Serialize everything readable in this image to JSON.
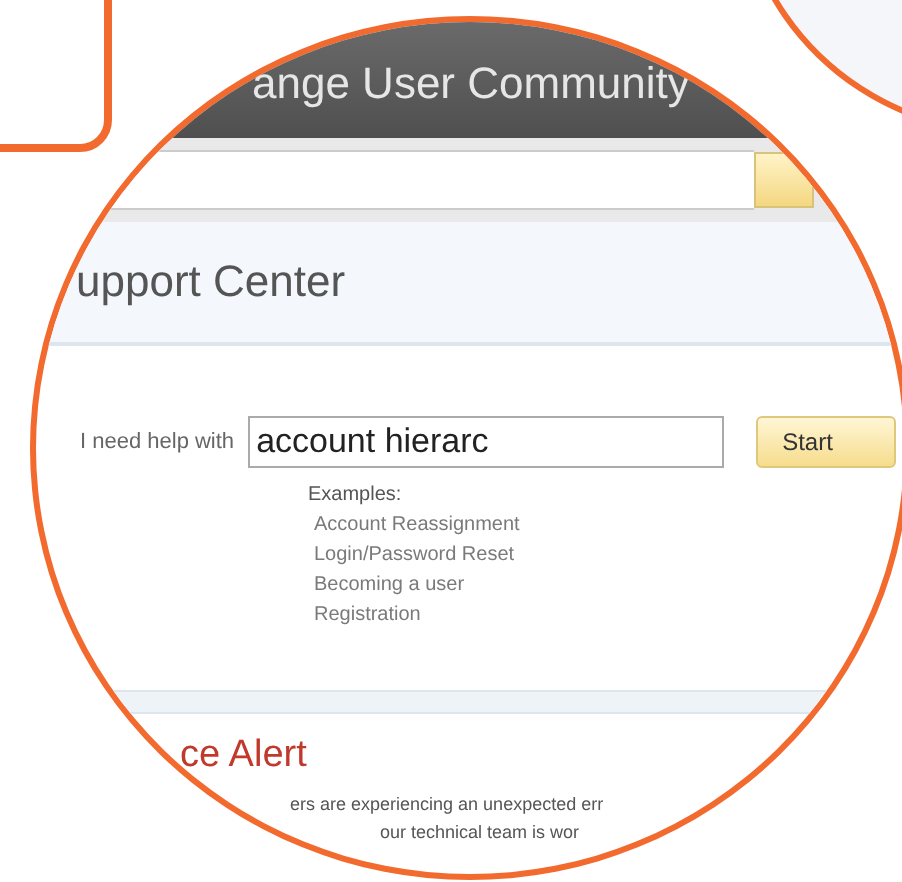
{
  "header": {
    "title": "ange User Community"
  },
  "support_center": {
    "title": "upport Center",
    "help_label": "I need help with",
    "query": "account hierarc",
    "start_button": "Start",
    "examples_label": "Examples:",
    "examples": [
      "Account Reassignment",
      "Login/Password Reset",
      "Becoming a user",
      "Registration"
    ]
  },
  "alert": {
    "title": "ce Alert",
    "lines": [
      "ers are experiencing an unexpected err",
      "our technical team is wor"
    ]
  }
}
